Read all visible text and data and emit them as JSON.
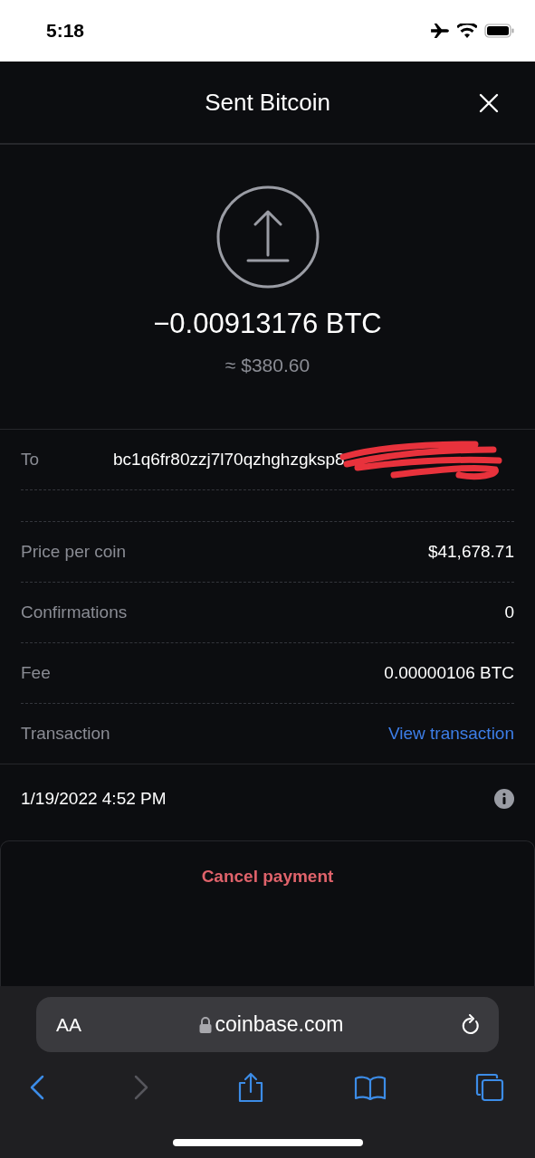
{
  "status_bar": {
    "time": "5:18"
  },
  "header": {
    "title": "Sent Bitcoin"
  },
  "summary": {
    "amount": "−0.00913176 BTC",
    "fiat": "≈ $380.60"
  },
  "details": [
    {
      "kind": "address",
      "label": "To",
      "value": "bc1q6fr80zzj7l70qzhghzgksp8",
      "redacted": true
    },
    {
      "kind": "blank"
    },
    {
      "kind": "text",
      "label": "Price per coin",
      "value": "$41,678.71"
    },
    {
      "kind": "text",
      "label": "Confirmations",
      "value": "0"
    },
    {
      "kind": "text",
      "label": "Fee",
      "value": "0.00000106 BTC"
    },
    {
      "kind": "link",
      "label": "Transaction",
      "value": "View transaction"
    }
  ],
  "date": "1/19/2022 4:52 PM",
  "cancel_button": "Cancel payment",
  "browser": {
    "text_size_button": "AA",
    "url": "coinbase.com",
    "toolbar": [
      {
        "kind": "back",
        "disabled": false
      },
      {
        "kind": "forward",
        "disabled": true
      },
      {
        "kind": "share",
        "disabled": false
      },
      {
        "kind": "bookmarks",
        "disabled": false
      },
      {
        "kind": "tabs",
        "disabled": false
      }
    ]
  }
}
